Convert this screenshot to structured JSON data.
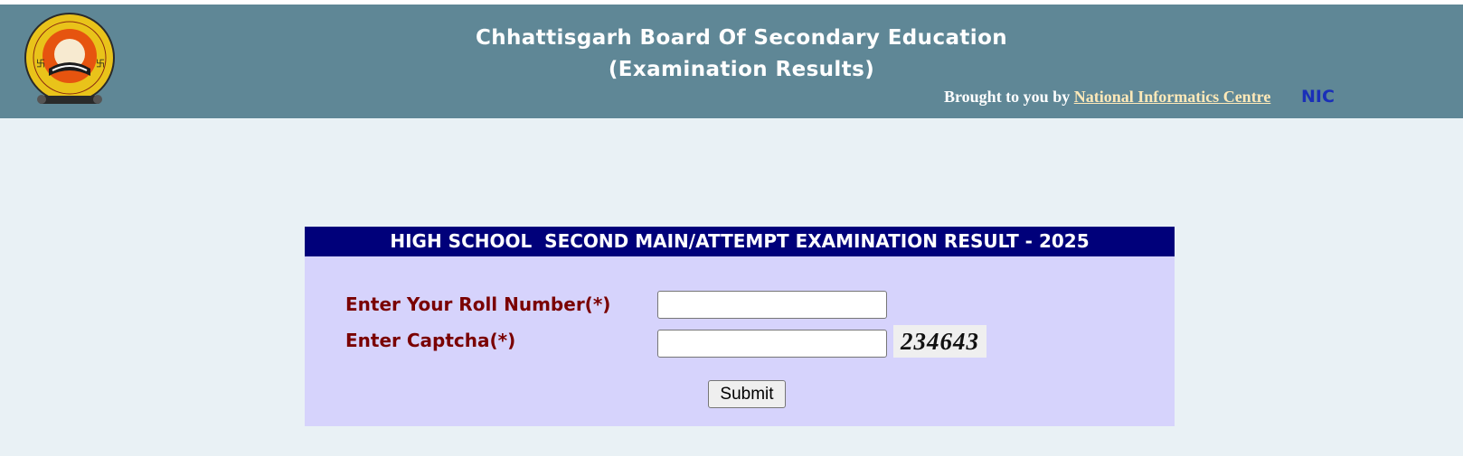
{
  "header": {
    "title_line1": "Chhattisgarh Board Of Secondary Education",
    "title_line2": "(Examination Results)",
    "credit_prefix": "Brought to you by",
    "credit_link": "National Informatics Centre",
    "nic_logo_text": "NIC"
  },
  "form": {
    "heading": "HIGH SCHOOL  SECOND MAIN/ATTEMPT EXAMINATION RESULT - 2025",
    "roll_label": "Enter Your Roll Number(*)",
    "roll_value": "",
    "captcha_label": "Enter Captcha(*)",
    "captcha_value": "",
    "captcha_code": "234643",
    "submit_label": "Submit"
  },
  "colors": {
    "header_bg": "#5f8796",
    "page_bg": "#e9f1f5",
    "panel_bg": "#d6d3fc",
    "panel_head_bg": "#00007a",
    "label_color": "#7a0000"
  }
}
